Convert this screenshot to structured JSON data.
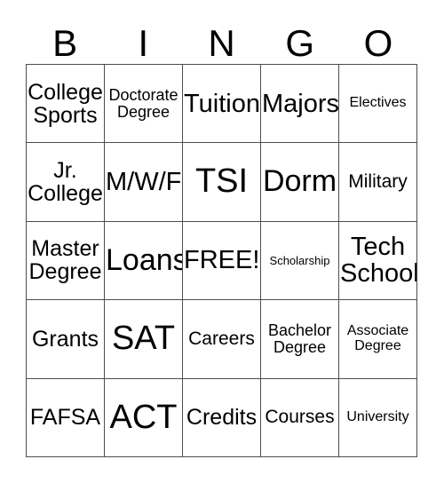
{
  "card": {
    "title": "BINGO",
    "header_letters": [
      "B",
      "I",
      "N",
      "G",
      "O"
    ],
    "columns": 5,
    "rows": 5,
    "free_space": "FREE!",
    "free_space_position": "row3-col3",
    "colors": {
      "background": "#ffffff",
      "text": "#000000",
      "grid_line": "#4d4d4d"
    },
    "cells": [
      {
        "text": "College\nSports",
        "size": "fs-m",
        "lines": 2
      },
      {
        "text": "Doctorate\nDegree",
        "size": "fs-xs",
        "lines": 2
      },
      {
        "text": "Tuition",
        "size": "fs-l",
        "lines": 1
      },
      {
        "text": "Majors",
        "size": "fs-l",
        "lines": 1
      },
      {
        "text": "Electives",
        "size": "fs-xxs",
        "lines": 1
      },
      {
        "text": "Jr.\nCollege",
        "size": "fs-m",
        "lines": 2
      },
      {
        "text": "M/W/F",
        "size": "fs-l",
        "lines": 1
      },
      {
        "text": "TSI",
        "size": "fs-xxl",
        "lines": 1
      },
      {
        "text": "Dorm",
        "size": "fs-xl",
        "lines": 1
      },
      {
        "text": "Military",
        "size": "fs-s",
        "lines": 1
      },
      {
        "text": "Master\nDegree",
        "size": "fs-m",
        "lines": 2
      },
      {
        "text": "Loans",
        "size": "fs-xl",
        "lines": 1
      },
      {
        "text": "FREE!",
        "size": "fs-l",
        "lines": 1
      },
      {
        "text": "Scholarship",
        "size": "fs-tiny",
        "lines": 1
      },
      {
        "text": "Tech\nSchool",
        "size": "fs-l",
        "lines": 2
      },
      {
        "text": "Grants",
        "size": "fs-m",
        "lines": 1
      },
      {
        "text": "SAT",
        "size": "fs-xxl",
        "lines": 1
      },
      {
        "text": "Careers",
        "size": "fs-s",
        "lines": 1
      },
      {
        "text": "Bachelor\nDegree",
        "size": "fs-xs",
        "lines": 2
      },
      {
        "text": "Associate\nDegree",
        "size": "fs-xxs",
        "lines": 2
      },
      {
        "text": "FAFSA",
        "size": "fs-m",
        "lines": 1
      },
      {
        "text": "ACT",
        "size": "fs-xxl",
        "lines": 1
      },
      {
        "text": "Credits",
        "size": "fs-m",
        "lines": 1
      },
      {
        "text": "Courses",
        "size": "fs-s",
        "lines": 1
      },
      {
        "text": "University",
        "size": "fs-xxs",
        "lines": 1
      }
    ]
  }
}
